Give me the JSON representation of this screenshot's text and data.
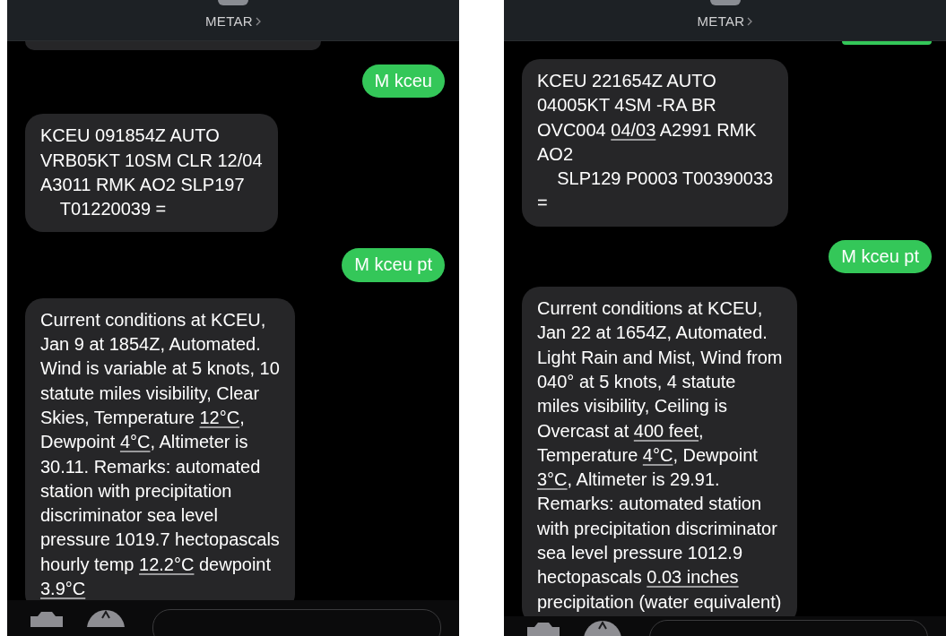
{
  "phones": [
    {
      "header": {
        "title": "METAR"
      },
      "messages": [
        {
          "kind": "partial",
          "outgoing": false
        },
        {
          "kind": "message",
          "outgoing": true,
          "segments": [
            {
              "kind": "text",
              "text": "M kceu"
            }
          ]
        },
        {
          "kind": "message",
          "outgoing": false,
          "segments": [
            {
              "kind": "text",
              "text": "KCEU 091854Z AUTO\nVRB05KT 10SM CLR 12/04\nA3011 RMK AO2 SLP197\n    T01220039 ="
            }
          ]
        },
        {
          "kind": "message",
          "outgoing": true,
          "segments": [
            {
              "kind": "text",
              "text": "M kceu pt"
            }
          ]
        },
        {
          "kind": "message",
          "outgoing": false,
          "segments": [
            {
              "kind": "text",
              "text": "Current conditions at KCEU,\nJan 9 at 1854Z, Automated.\nWind is variable at 5 knots, 10\nstatute miles visibility, Clear\nSkies, Temperature "
            },
            {
              "kind": "link",
              "text": "12°C"
            },
            {
              "kind": "text",
              "text": ",\nDewpoint "
            },
            {
              "kind": "link",
              "text": "4°C"
            },
            {
              "kind": "text",
              "text": ", Altimeter is\n30.11. Remarks: automated\nstation with precipitation\ndiscriminator sea level\npressure 1019.7 hectopascals\nhourly temp "
            },
            {
              "kind": "link",
              "text": "12.2°C"
            },
            {
              "kind": "text",
              "text": " dewpoint\n"
            },
            {
              "kind": "link",
              "text": "3.9°C"
            }
          ]
        }
      ]
    },
    {
      "header": {
        "title": "METAR"
      },
      "messages": [
        {
          "kind": "partial",
          "outgoing": true
        },
        {
          "kind": "message",
          "outgoing": false,
          "segments": [
            {
              "kind": "text",
              "text": "KCEU 221654Z AUTO\n04005KT 4SM -RA BR\nOVC004 "
            },
            {
              "kind": "link",
              "text": "04/03"
            },
            {
              "kind": "text",
              "text": " A2991 RMK\nAO2\n    SLP129 P0003 T00390033\n="
            }
          ]
        },
        {
          "kind": "message",
          "outgoing": true,
          "segments": [
            {
              "kind": "text",
              "text": "M kceu pt"
            }
          ]
        },
        {
          "kind": "message",
          "outgoing": false,
          "segments": [
            {
              "kind": "text",
              "text": "Current conditions at KCEU,\nJan 22 at 1654Z, Automated.\nLight Rain and Mist, Wind from\n040° at 5 knots, 4 statute\nmiles visibility, Ceiling is\nOvercast at "
            },
            {
              "kind": "link",
              "text": "400 feet"
            },
            {
              "kind": "text",
              "text": ",\nTemperature "
            },
            {
              "kind": "link",
              "text": "4°C"
            },
            {
              "kind": "text",
              "text": ", Dewpoint\n"
            },
            {
              "kind": "link",
              "text": "3°C"
            },
            {
              "kind": "text",
              "text": ", Altimeter is 29.91.\nRemarks: automated station\nwith precipitation discriminator\nsea level pressure 1012.9\nhectopascals "
            },
            {
              "kind": "link",
              "text": "0.03 inches"
            },
            {
              "kind": "text",
              "text": "\nprecipitation (water equivalent)"
            }
          ]
        }
      ]
    }
  ]
}
